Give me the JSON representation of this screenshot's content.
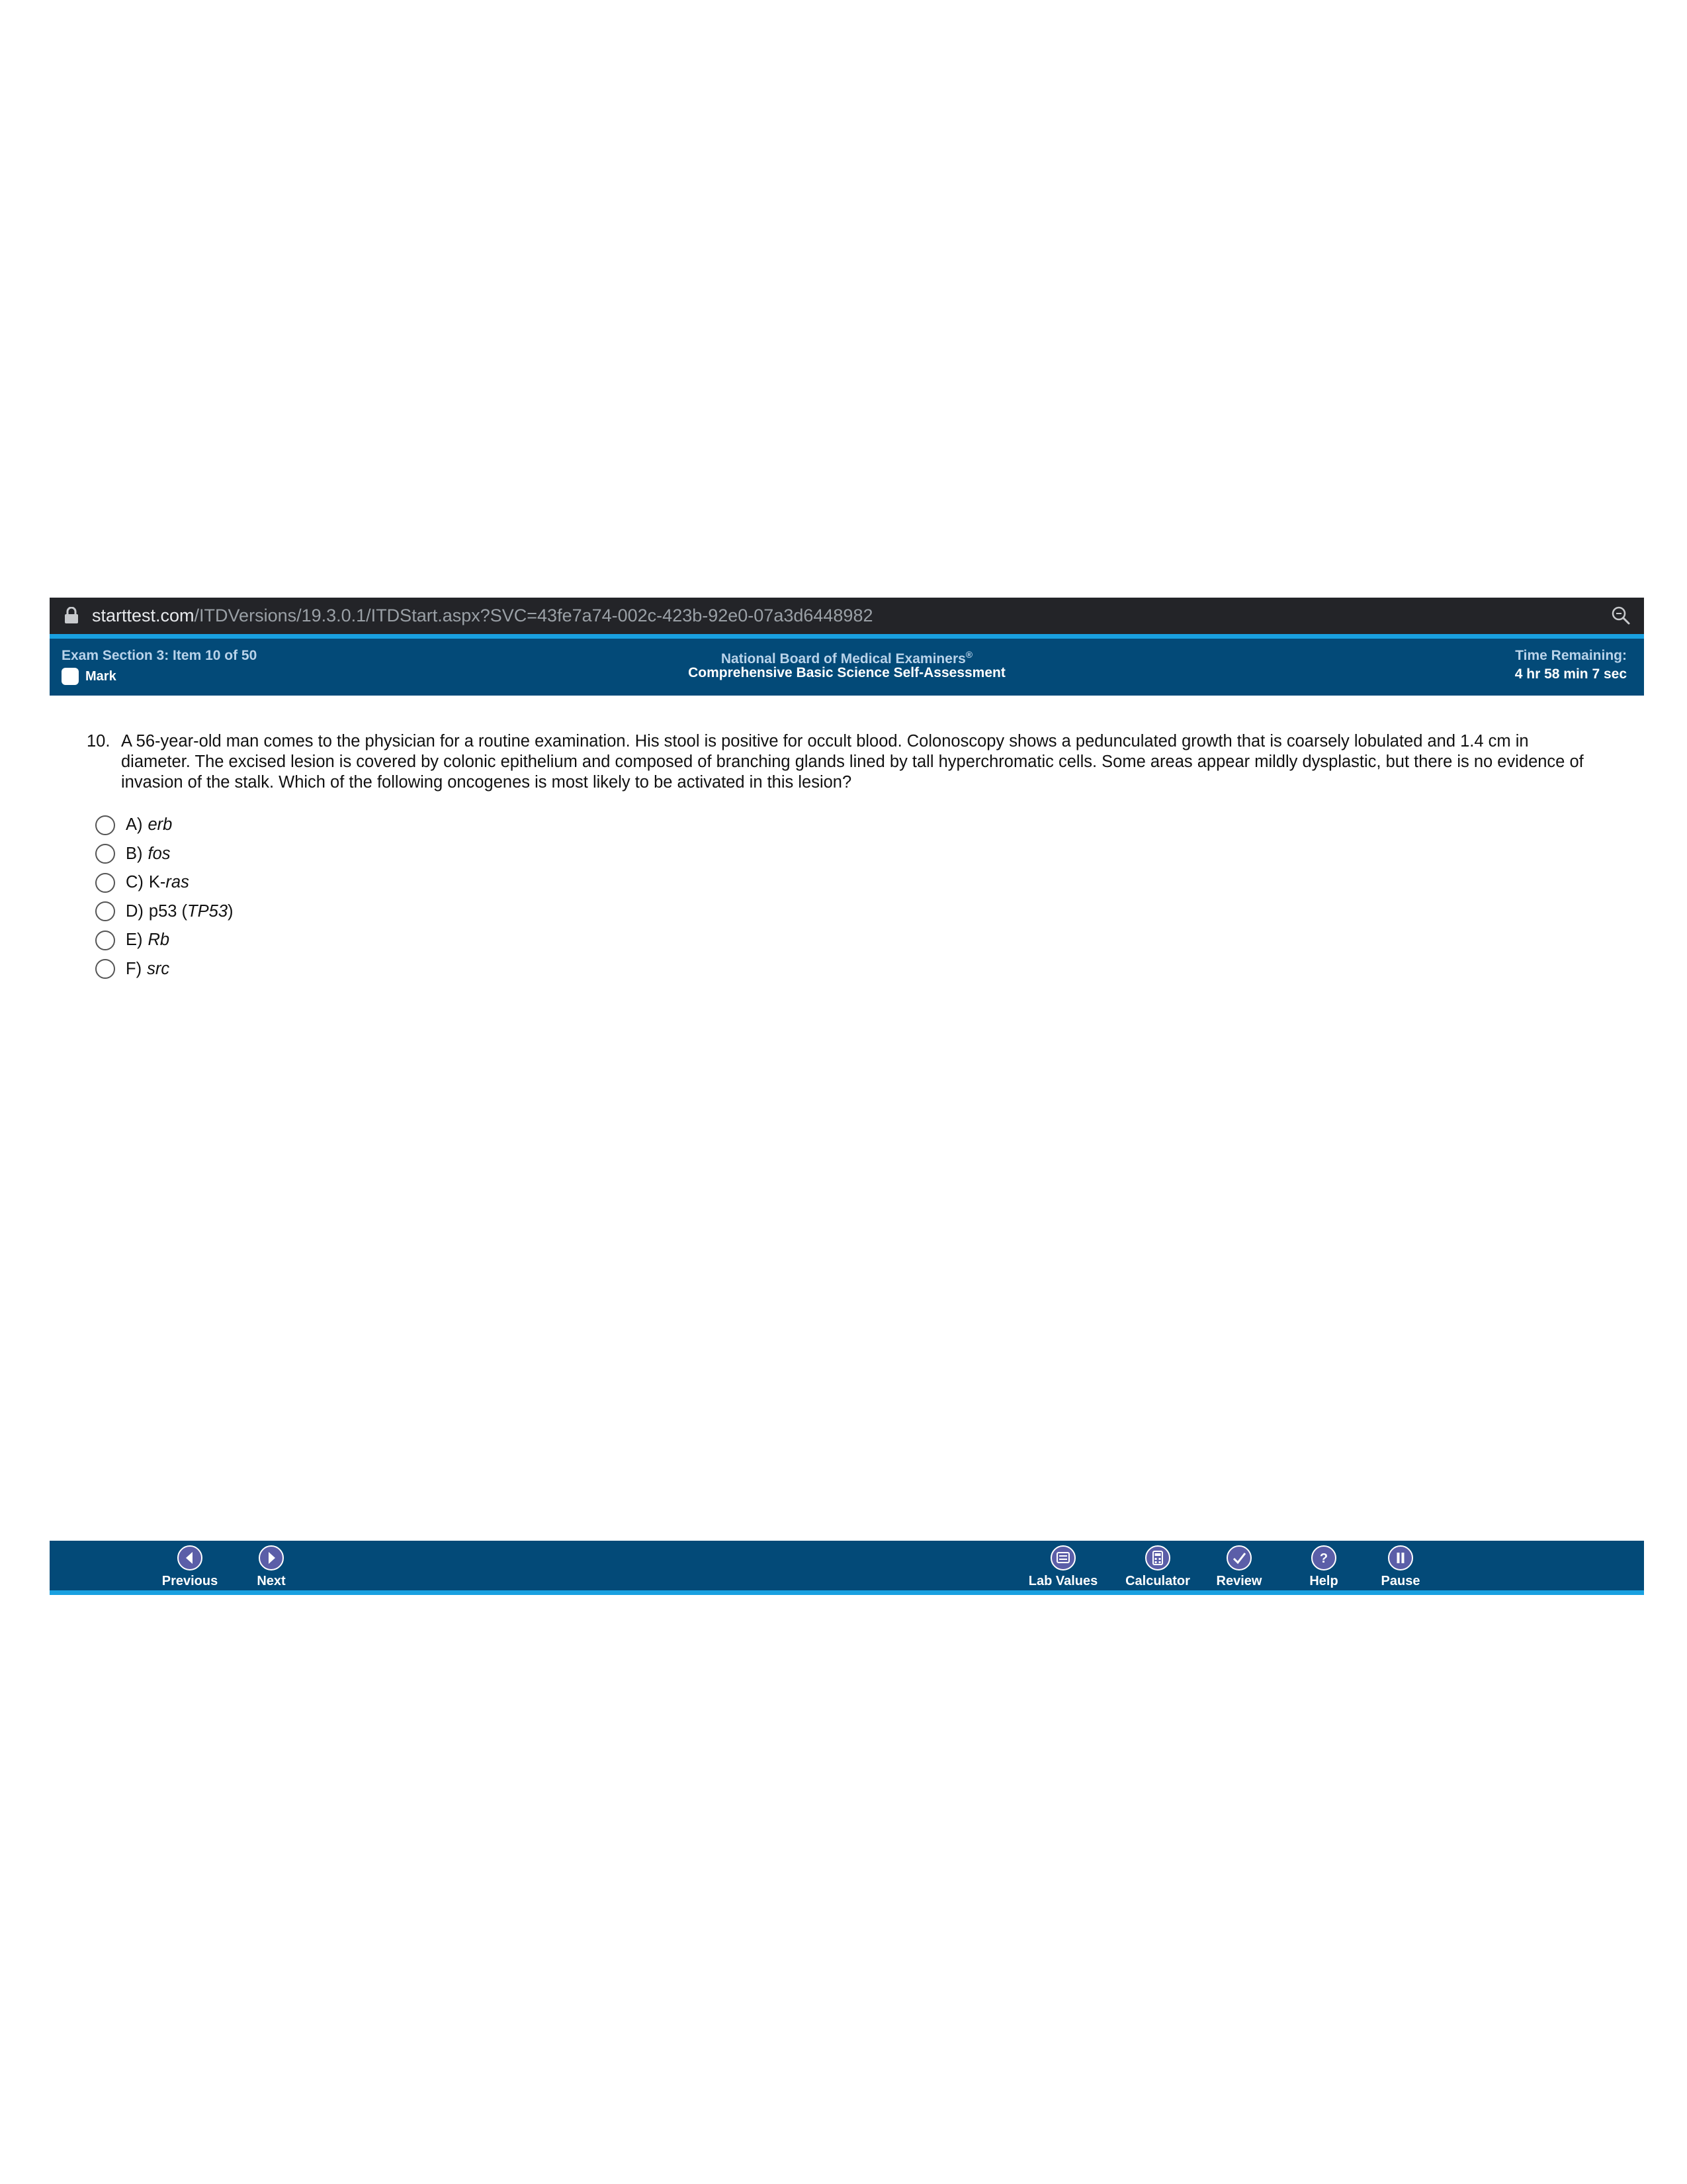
{
  "browser": {
    "url_host": "starttest.com",
    "url_path": "/ITDVersions/19.3.0.1/ITDStart.aspx?SVC=43fe7a74-002c-423b-92e0-07a3d6448982"
  },
  "header": {
    "section": "Exam Section 3: Item 10 of 50",
    "mark_label": "Mark",
    "organization": "National Board of Medical Examiners",
    "registered": "®",
    "exam_name": "Comprehensive Basic Science Self-Assessment",
    "time_label": "Time Remaining:",
    "time_value": "4 hr 58 min 7 sec"
  },
  "question": {
    "number": "10.",
    "text": "A 56-year-old man comes to the physician for a routine examination. His stool is positive for occult blood. Colonoscopy shows a pedunculated growth that is coarsely lobulated and 1.4 cm in diameter. The excised lesion is covered by colonic epithelium and composed of branching glands lined by tall hyperchromatic cells. Some areas appear mildly dysplastic, but there is no evidence of invasion of the stalk. Which of the following oncogenes is most likely to be activated in this lesion?",
    "options": [
      {
        "letter": "A)",
        "pre": "",
        "italic": "erb",
        "post": ""
      },
      {
        "letter": "B)",
        "pre": "",
        "italic": "fos",
        "post": ""
      },
      {
        "letter": "C)",
        "pre": "K-",
        "italic": "ras",
        "post": ""
      },
      {
        "letter": "D)",
        "pre": "p53 (",
        "italic": "TP53",
        "post": ")"
      },
      {
        "letter": "E)",
        "pre": "",
        "italic": "Rb",
        "post": ""
      },
      {
        "letter": "F)",
        "pre": "",
        "italic": "src",
        "post": ""
      }
    ]
  },
  "footer": {
    "previous": "Previous",
    "next": "Next",
    "lab_values": "Lab Values",
    "calculator": "Calculator",
    "review": "Review",
    "help": "Help",
    "pause": "Pause"
  },
  "colors": {
    "header_bg": "#034a78",
    "accent": "#19a0e0",
    "icon_purple": "#5b5ea8"
  }
}
